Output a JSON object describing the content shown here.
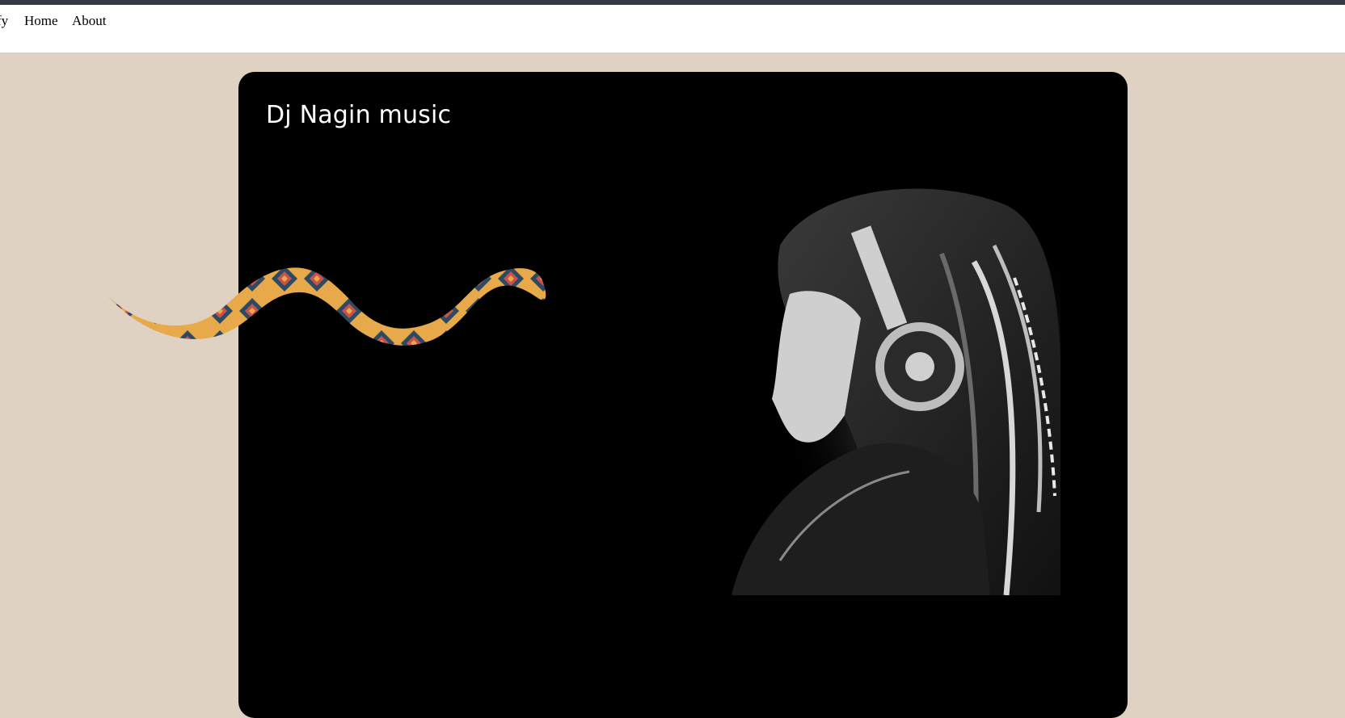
{
  "nav": {
    "cut_label": "fy",
    "home_label": "Home",
    "about_label": "About"
  },
  "card": {
    "title": "Dj Nagin music"
  },
  "colors": {
    "page_background": "#dfd2c2",
    "top_strip": "#343a44",
    "card_background": "#000000",
    "snake_body": "#e8a94a",
    "snake_diamond": "#2d4a63",
    "snake_diamond_inner": "#c9534a"
  },
  "icons": {
    "photo": "dj-headphones-photo",
    "snake": "snake-graphic"
  }
}
